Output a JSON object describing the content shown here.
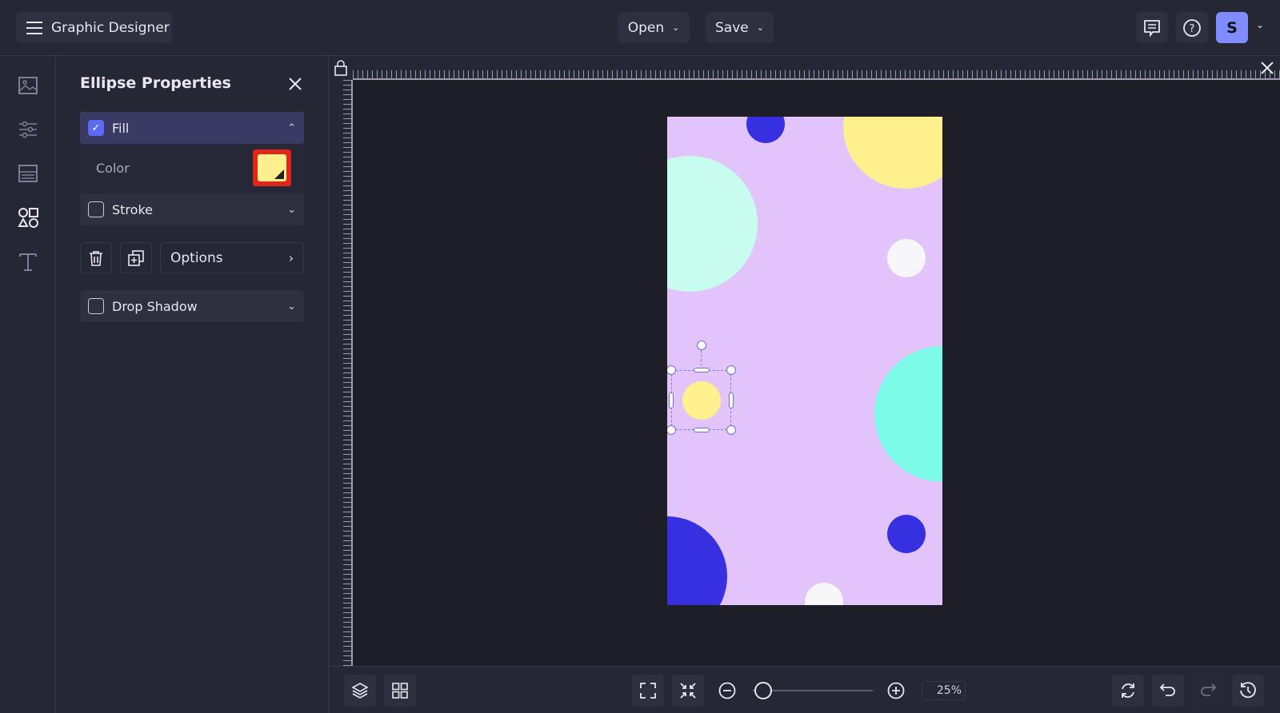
{
  "header": {
    "app_title": "Graphic Designer",
    "open_label": "Open",
    "save_label": "Save",
    "avatar_initial": "S"
  },
  "panel": {
    "title": "Ellipse Properties",
    "fill_label": "Fill",
    "fill_checked": true,
    "color_label": "Color",
    "fill_color": "#fdf08d",
    "stroke_label": "Stroke",
    "options_label": "Options",
    "drop_shadow_label": "Drop Shadow"
  },
  "zoom": {
    "value_label": "25%",
    "percent": 25
  },
  "colors": {
    "accent": "#5b6cf0",
    "artboard": "#e2c4fb",
    "highlight": "#e1251b"
  }
}
